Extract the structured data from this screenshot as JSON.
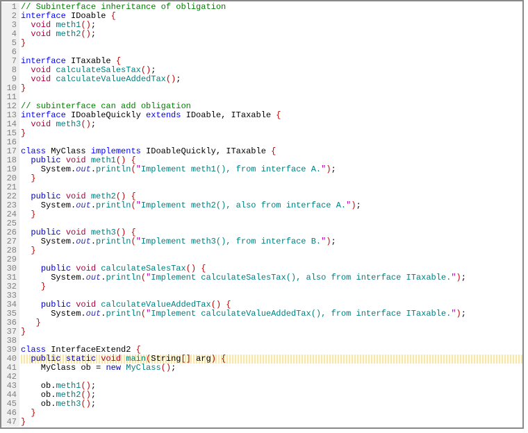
{
  "lineCount": 47,
  "highlightedLine": 40,
  "lines": [
    [
      [
        "c-comment",
        "// Subinterface inheritance of obligation"
      ]
    ],
    [
      [
        "c-keyword2",
        "interface "
      ],
      [
        "c-ident",
        "IDoable "
      ],
      [
        "c-brace",
        "{"
      ]
    ],
    [
      [
        "c-ident",
        "  "
      ],
      [
        "c-type",
        "void "
      ],
      [
        "c-method",
        "meth1"
      ],
      [
        "c-paren",
        "()"
      ],
      [
        "c-semi",
        ";"
      ]
    ],
    [
      [
        "c-ident",
        "  "
      ],
      [
        "c-type",
        "void "
      ],
      [
        "c-method",
        "meth2"
      ],
      [
        "c-paren",
        "()"
      ],
      [
        "c-semi",
        ";"
      ]
    ],
    [
      [
        "c-brace",
        "}"
      ]
    ],
    [],
    [
      [
        "c-keyword2",
        "interface "
      ],
      [
        "c-ident",
        "ITaxable "
      ],
      [
        "c-brace",
        "{"
      ]
    ],
    [
      [
        "c-ident",
        "  "
      ],
      [
        "c-type",
        "void "
      ],
      [
        "c-method",
        "calculateSalesTax"
      ],
      [
        "c-paren",
        "()"
      ],
      [
        "c-semi",
        ";"
      ]
    ],
    [
      [
        "c-ident",
        "  "
      ],
      [
        "c-type",
        "void "
      ],
      [
        "c-method",
        "calculateValueAddedTax"
      ],
      [
        "c-paren",
        "()"
      ],
      [
        "c-semi",
        ";"
      ]
    ],
    [
      [
        "c-brace",
        "}"
      ]
    ],
    [],
    [
      [
        "c-comment",
        "// subinterface can add obligation"
      ]
    ],
    [
      [
        "c-keyword2",
        "interface "
      ],
      [
        "c-ident",
        "IDoableQuickly "
      ],
      [
        "c-keyword2",
        "extends "
      ],
      [
        "c-ident",
        "IDoable"
      ],
      [
        "c-op",
        ", "
      ],
      [
        "c-ident",
        "ITaxable "
      ],
      [
        "c-brace",
        "{"
      ]
    ],
    [
      [
        "c-ident",
        "  "
      ],
      [
        "c-type",
        "void "
      ],
      [
        "c-method",
        "meth3"
      ],
      [
        "c-paren",
        "()"
      ],
      [
        "c-semi",
        ";"
      ]
    ],
    [
      [
        "c-brace",
        "}"
      ]
    ],
    [],
    [
      [
        "c-keyword2",
        "class "
      ],
      [
        "c-ident",
        "MyClass "
      ],
      [
        "c-keyword2",
        "implements "
      ],
      [
        "c-ident",
        "IDoableQuickly"
      ],
      [
        "c-op",
        ", "
      ],
      [
        "c-ident",
        "ITaxable "
      ],
      [
        "c-brace",
        "{"
      ]
    ],
    [
      [
        "c-ident",
        "  "
      ],
      [
        "c-keyword",
        "public "
      ],
      [
        "c-type",
        "void "
      ],
      [
        "c-method",
        "meth1"
      ],
      [
        "c-paren",
        "() "
      ],
      [
        "c-brace",
        "{"
      ]
    ],
    [
      [
        "c-ident",
        "    System"
      ],
      [
        "c-op",
        "."
      ],
      [
        "c-static",
        "out"
      ],
      [
        "c-op",
        "."
      ],
      [
        "c-method",
        "println"
      ],
      [
        "c-paren",
        "("
      ],
      [
        "c-quote",
        "\""
      ],
      [
        "c-string",
        "Implement meth1(), from interface A."
      ],
      [
        "c-quote",
        "\""
      ],
      [
        "c-paren",
        ")"
      ],
      [
        "c-semi",
        ";"
      ]
    ],
    [
      [
        "c-ident",
        "  "
      ],
      [
        "c-brace",
        "}"
      ]
    ],
    [],
    [
      [
        "c-ident",
        "  "
      ],
      [
        "c-keyword",
        "public "
      ],
      [
        "c-type",
        "void "
      ],
      [
        "c-method",
        "meth2"
      ],
      [
        "c-paren",
        "() "
      ],
      [
        "c-brace",
        "{"
      ]
    ],
    [
      [
        "c-ident",
        "    System"
      ],
      [
        "c-op",
        "."
      ],
      [
        "c-static",
        "out"
      ],
      [
        "c-op",
        "."
      ],
      [
        "c-method",
        "println"
      ],
      [
        "c-paren",
        "("
      ],
      [
        "c-quote",
        "\""
      ],
      [
        "c-string",
        "Implement meth2(), also from interface A."
      ],
      [
        "c-quote",
        "\""
      ],
      [
        "c-paren",
        ")"
      ],
      [
        "c-semi",
        ";"
      ]
    ],
    [
      [
        "c-ident",
        "  "
      ],
      [
        "c-brace",
        "}"
      ]
    ],
    [],
    [
      [
        "c-ident",
        "  "
      ],
      [
        "c-keyword",
        "public "
      ],
      [
        "c-type",
        "void "
      ],
      [
        "c-method",
        "meth3"
      ],
      [
        "c-paren",
        "() "
      ],
      [
        "c-brace",
        "{"
      ]
    ],
    [
      [
        "c-ident",
        "    System"
      ],
      [
        "c-op",
        "."
      ],
      [
        "c-static",
        "out"
      ],
      [
        "c-op",
        "."
      ],
      [
        "c-method",
        "println"
      ],
      [
        "c-paren",
        "("
      ],
      [
        "c-quote",
        "\""
      ],
      [
        "c-string",
        "Implement meth3(), from interface B."
      ],
      [
        "c-quote",
        "\""
      ],
      [
        "c-paren",
        ")"
      ],
      [
        "c-semi",
        ";"
      ]
    ],
    [
      [
        "c-ident",
        "  "
      ],
      [
        "c-brace",
        "}"
      ]
    ],
    [],
    [
      [
        "c-ident",
        "    "
      ],
      [
        "c-keyword",
        "public "
      ],
      [
        "c-type",
        "void "
      ],
      [
        "c-method",
        "calculateSalesTax"
      ],
      [
        "c-paren",
        "() "
      ],
      [
        "c-brace",
        "{"
      ]
    ],
    [
      [
        "c-ident",
        "      System"
      ],
      [
        "c-op",
        "."
      ],
      [
        "c-static",
        "out"
      ],
      [
        "c-op",
        "."
      ],
      [
        "c-method",
        "println"
      ],
      [
        "c-paren",
        "("
      ],
      [
        "c-quote",
        "\""
      ],
      [
        "c-string",
        "Implement calculateSalesTax(), also from interface ITaxable."
      ],
      [
        "c-quote",
        "\""
      ],
      [
        "c-paren",
        ")"
      ],
      [
        "c-semi",
        ";"
      ]
    ],
    [
      [
        "c-ident",
        "    "
      ],
      [
        "c-brace",
        "}"
      ]
    ],
    [],
    [
      [
        "c-ident",
        "    "
      ],
      [
        "c-keyword",
        "public "
      ],
      [
        "c-type",
        "void "
      ],
      [
        "c-method",
        "calculateValueAddedTax"
      ],
      [
        "c-paren",
        "() "
      ],
      [
        "c-brace",
        "{"
      ]
    ],
    [
      [
        "c-ident",
        "      System"
      ],
      [
        "c-op",
        "."
      ],
      [
        "c-static",
        "out"
      ],
      [
        "c-op",
        "."
      ],
      [
        "c-method",
        "println"
      ],
      [
        "c-paren",
        "("
      ],
      [
        "c-quote",
        "\""
      ],
      [
        "c-string",
        "Implement calculateValueAddedTax(), from interface ITaxable."
      ],
      [
        "c-quote",
        "\""
      ],
      [
        "c-paren",
        ")"
      ],
      [
        "c-semi",
        ";"
      ]
    ],
    [
      [
        "c-ident",
        "   "
      ],
      [
        "c-brace",
        "}"
      ]
    ],
    [
      [
        "c-brace",
        "}"
      ]
    ],
    [],
    [
      [
        "c-keyword2",
        "class "
      ],
      [
        "c-ident",
        "InterfaceExtend2 "
      ],
      [
        "c-brace",
        "{"
      ]
    ],
    [
      [
        "c-ident",
        "  "
      ],
      [
        "c-keyword",
        "public static "
      ],
      [
        "c-type",
        "void "
      ],
      [
        "c-method",
        "main"
      ],
      [
        "c-paren",
        "("
      ],
      [
        "c-ident",
        "String"
      ],
      [
        "c-paren",
        "[] "
      ],
      [
        "c-ident",
        "arg"
      ],
      [
        "c-paren",
        ") "
      ],
      [
        "c-brace",
        "{"
      ]
    ],
    [
      [
        "c-ident",
        "    MyClass ob "
      ],
      [
        "c-op",
        "= "
      ],
      [
        "c-keyword",
        "new "
      ],
      [
        "c-method",
        "MyClass"
      ],
      [
        "c-paren",
        "()"
      ],
      [
        "c-semi",
        ";"
      ]
    ],
    [],
    [
      [
        "c-ident",
        "    ob"
      ],
      [
        "c-op",
        "."
      ],
      [
        "c-method",
        "meth1"
      ],
      [
        "c-paren",
        "()"
      ],
      [
        "c-semi",
        ";"
      ]
    ],
    [
      [
        "c-ident",
        "    ob"
      ],
      [
        "c-op",
        "."
      ],
      [
        "c-method",
        "meth2"
      ],
      [
        "c-paren",
        "()"
      ],
      [
        "c-semi",
        ";"
      ]
    ],
    [
      [
        "c-ident",
        "    ob"
      ],
      [
        "c-op",
        "."
      ],
      [
        "c-method",
        "meth3"
      ],
      [
        "c-paren",
        "()"
      ],
      [
        "c-semi",
        ";"
      ]
    ],
    [
      [
        "c-ident",
        "  "
      ],
      [
        "c-brace",
        "}"
      ]
    ],
    [
      [
        "c-brace",
        "}"
      ]
    ]
  ]
}
